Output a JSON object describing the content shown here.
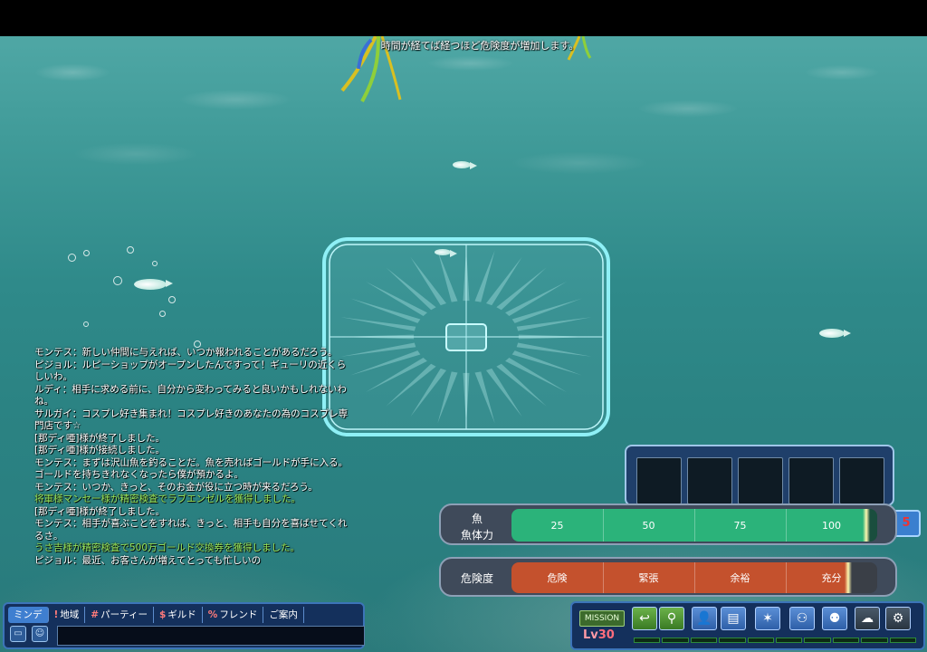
{
  "notice": "時間が経てば経つほど危険度が増加します。",
  "chat": [
    {
      "text": "モンテス：新しい仲間に与えれば、いつか報われることがあるだろう。",
      "color": "white"
    },
    {
      "text": "ピジョル：ルピーショップがオープンしたんですって！ギューリの近くらしいわ。",
      "color": "white"
    },
    {
      "text": "ルディ：相手に求める前に、自分から変わってみると良いかもしれないわね。",
      "color": "white"
    },
    {
      "text": "サルガイ：コスプレ好き集まれ！コスプレ好きのあなたの為のコスプレ専門店です☆",
      "color": "white"
    },
    {
      "text": "[那ディ唖]様が終了しました。",
      "color": "white"
    },
    {
      "text": "[那ディ唖]様が接続しました。",
      "color": "white"
    },
    {
      "text": "モンテス：まずは沢山魚を釣ることだ。魚を売ればゴールドが手に入る。ゴールドを持ちきれなくなったら僕が預かるよ。",
      "color": "white"
    },
    {
      "text": "モンテス：いつか、きっと、そのお金が役に立つ時が来るだろう。",
      "color": "white"
    },
    {
      "text": "将軍様マンセー様が精密検査でラブエンゼルを獲得しました。",
      "color": "green"
    },
    {
      "text": "[那ディ唖]様が終了しました。",
      "color": "white"
    },
    {
      "text": "モンテス：相手が喜ぶことをすれば、きっと、相手も自分を喜ばせてくれるさ。",
      "color": "white"
    },
    {
      "text": "うさ吉様が精密検査で500万ゴールド交換券を獲得しました。",
      "color": "green"
    },
    {
      "text": "ピジョル：最近、お客さんが増えてとっても忙しいの",
      "color": "white"
    }
  ],
  "gauges": {
    "fish": {
      "label_top": "魚",
      "label_bottom": "魚体力",
      "ticks": [
        "25",
        "50",
        "75",
        "100"
      ],
      "value": 0.97,
      "color": "#2bb37a"
    },
    "danger": {
      "label": "危険度",
      "ticks": [
        "危険",
        "緊張",
        "余裕",
        "充分"
      ],
      "value": 0.92,
      "color": "#c4512d"
    }
  },
  "side_badge": "5",
  "chat_tabs": [
    {
      "key": "",
      "label": "ミンデ",
      "active": true
    },
    {
      "key": "!",
      "label": "地域",
      "active": false
    },
    {
      "key": "#",
      "label": "パーティー",
      "active": false
    },
    {
      "key": "$",
      "label": "ギルド",
      "active": false
    },
    {
      "key": "%",
      "label": "フレンド",
      "active": false
    },
    {
      "key": "",
      "label": "ご案内",
      "active": false
    }
  ],
  "chat_input": {
    "value": ""
  },
  "menu": {
    "mission": "MISSION",
    "lv_prefix": "Lv",
    "level": "30",
    "icons": [
      "return-icon",
      "character-icon",
      "profile-icon",
      "inventory-icon",
      "skill-icon",
      "party-add-icon",
      "party-icon",
      "chat-bubble-icon",
      "settings-gear-icon"
    ]
  }
}
